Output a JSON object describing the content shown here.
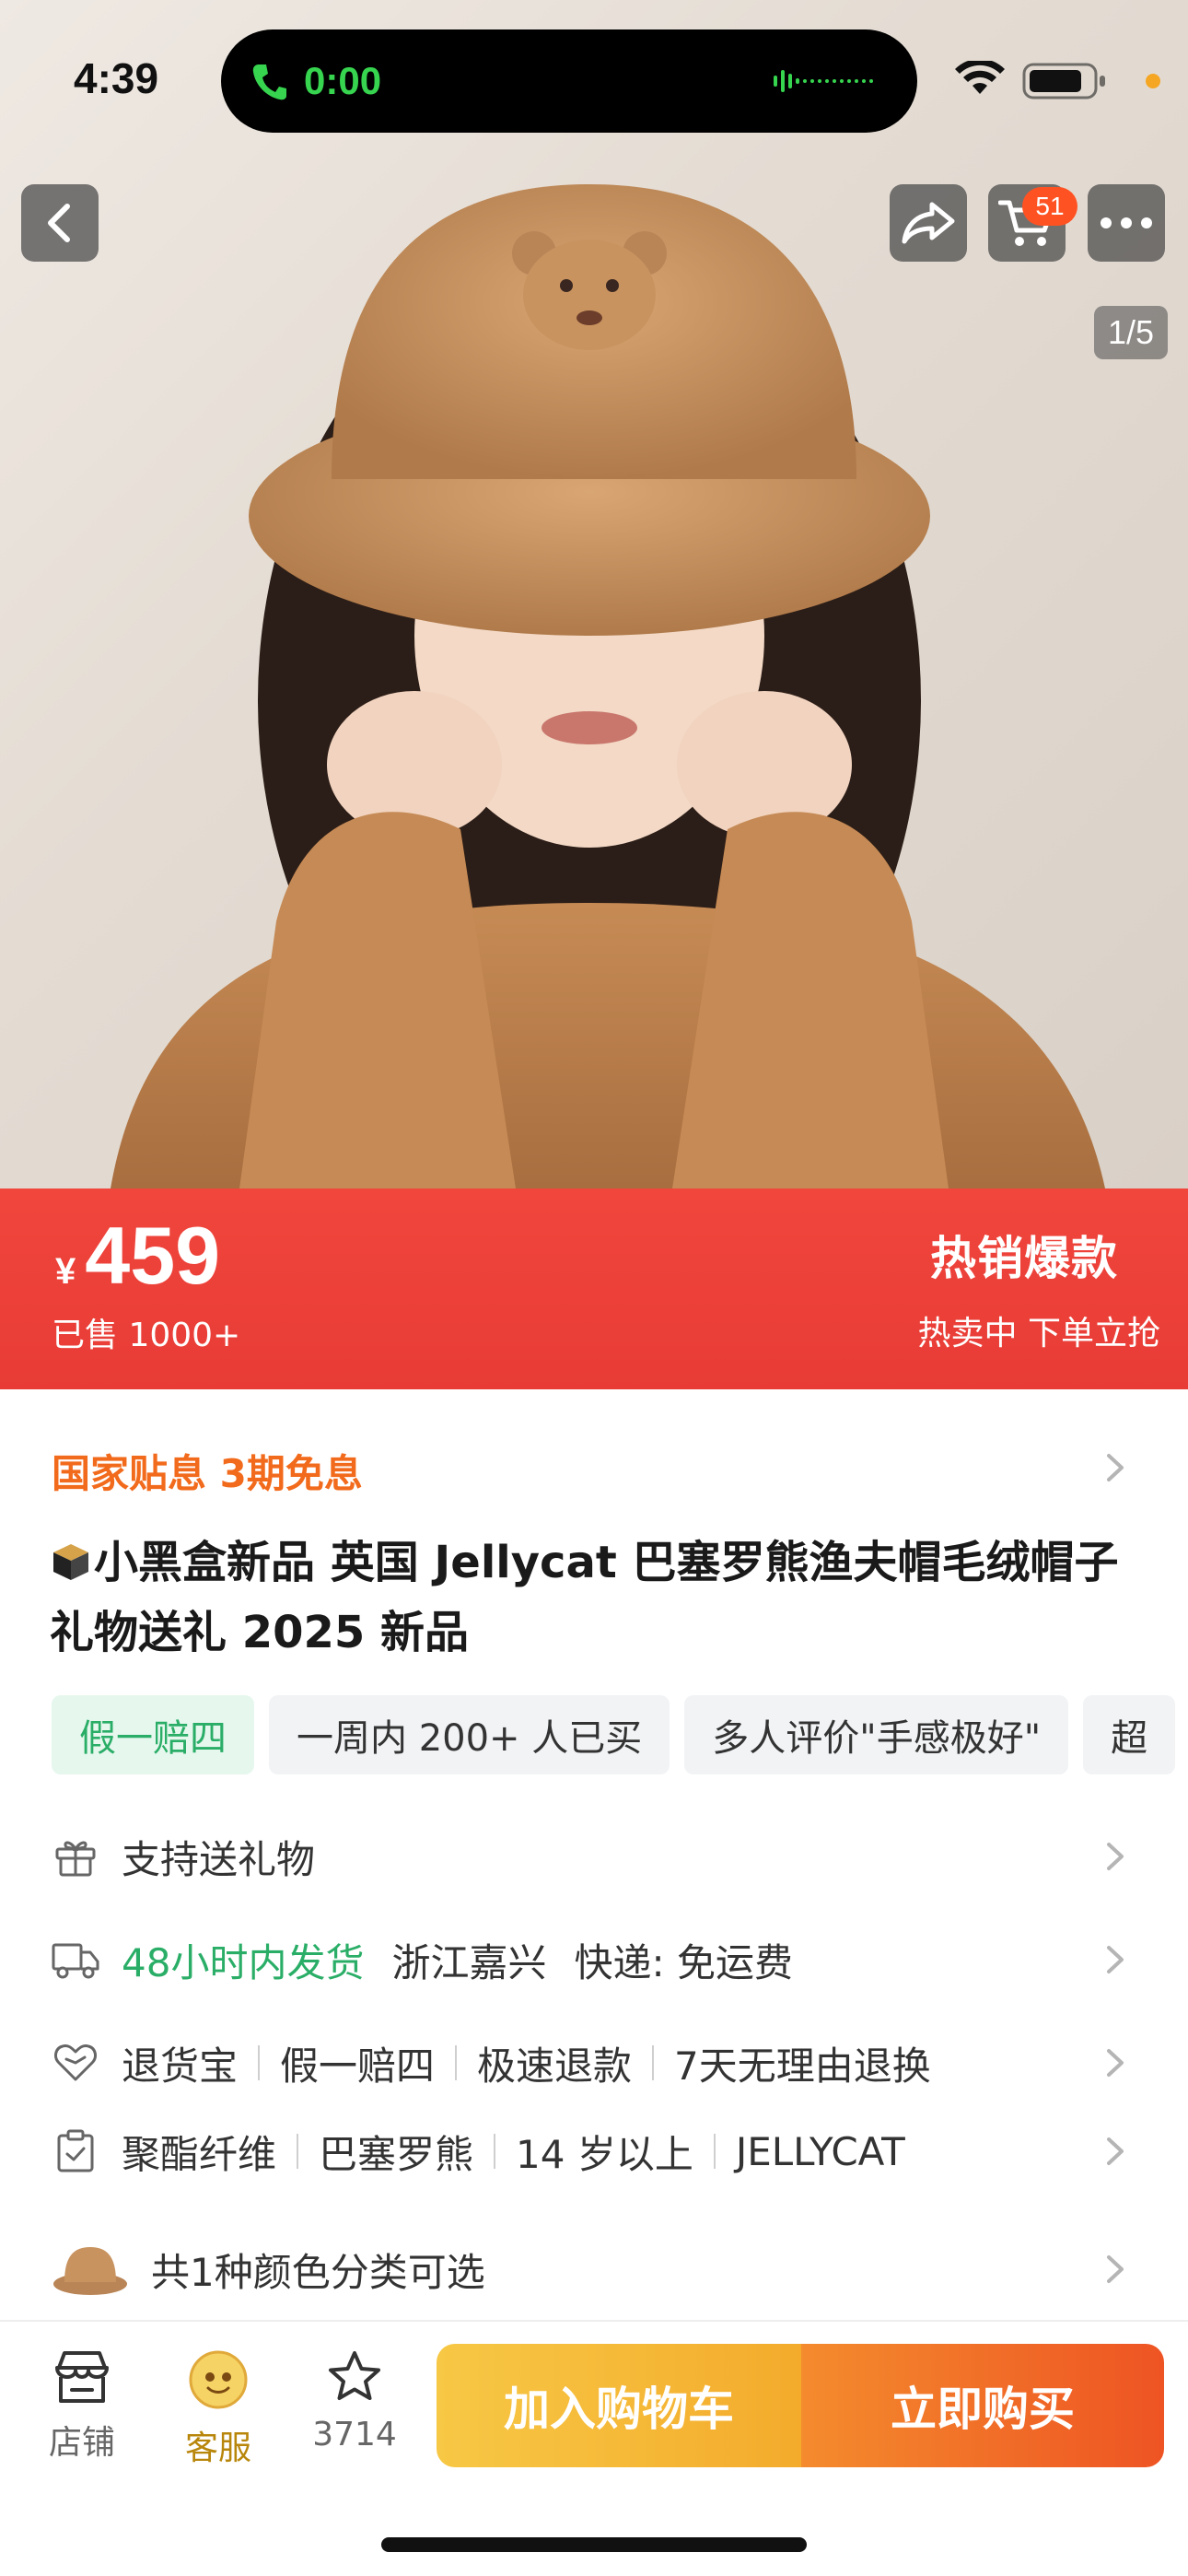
{
  "status_bar": {
    "time": "4:39",
    "call_time": "0:00"
  },
  "header": {
    "cart_badge": "51",
    "image_page": "1/5"
  },
  "price_banner": {
    "currency": "¥",
    "price": "459",
    "sold": "已售 1000+",
    "hot_title": "热销爆款",
    "hot_subtitle": "热卖中 下单立抢"
  },
  "product": {
    "subsidy": "国家贴息 3期免息",
    "title": "小黑盒新品 英国 Jellycat 巴塞罗熊渔夫帽毛绒帽子礼物送礼 2025 新品",
    "tags": [
      "假一赔四",
      "一周内 200+ 人已买",
      "多人评价\"手感极好\"",
      "超"
    ]
  },
  "rows": {
    "gift": "支持送礼物",
    "shipping_time": "48小时内发货",
    "shipping_origin": "浙江嘉兴",
    "shipping_fee": "快递: 免运费",
    "service": [
      "退货宝",
      "假一赔四",
      "极速退款",
      "7天无理由退换"
    ],
    "params": [
      "聚酯纤维",
      "巴塞罗熊",
      "14 岁以上",
      "JELLYCAT"
    ],
    "colors": "共1种颜色分类可选"
  },
  "bottom_bar": {
    "shop": "店铺",
    "service": "客服",
    "favorites": "3714",
    "add_to_cart": "加入购物车",
    "buy_now": "立即购买"
  },
  "colors": {
    "price_red": "#e83b36",
    "subsidy_orange": "#f26a1b",
    "green": "#2aae67",
    "cart_yellow": "#f4ab2c",
    "buy_orange": "#ee5423"
  }
}
